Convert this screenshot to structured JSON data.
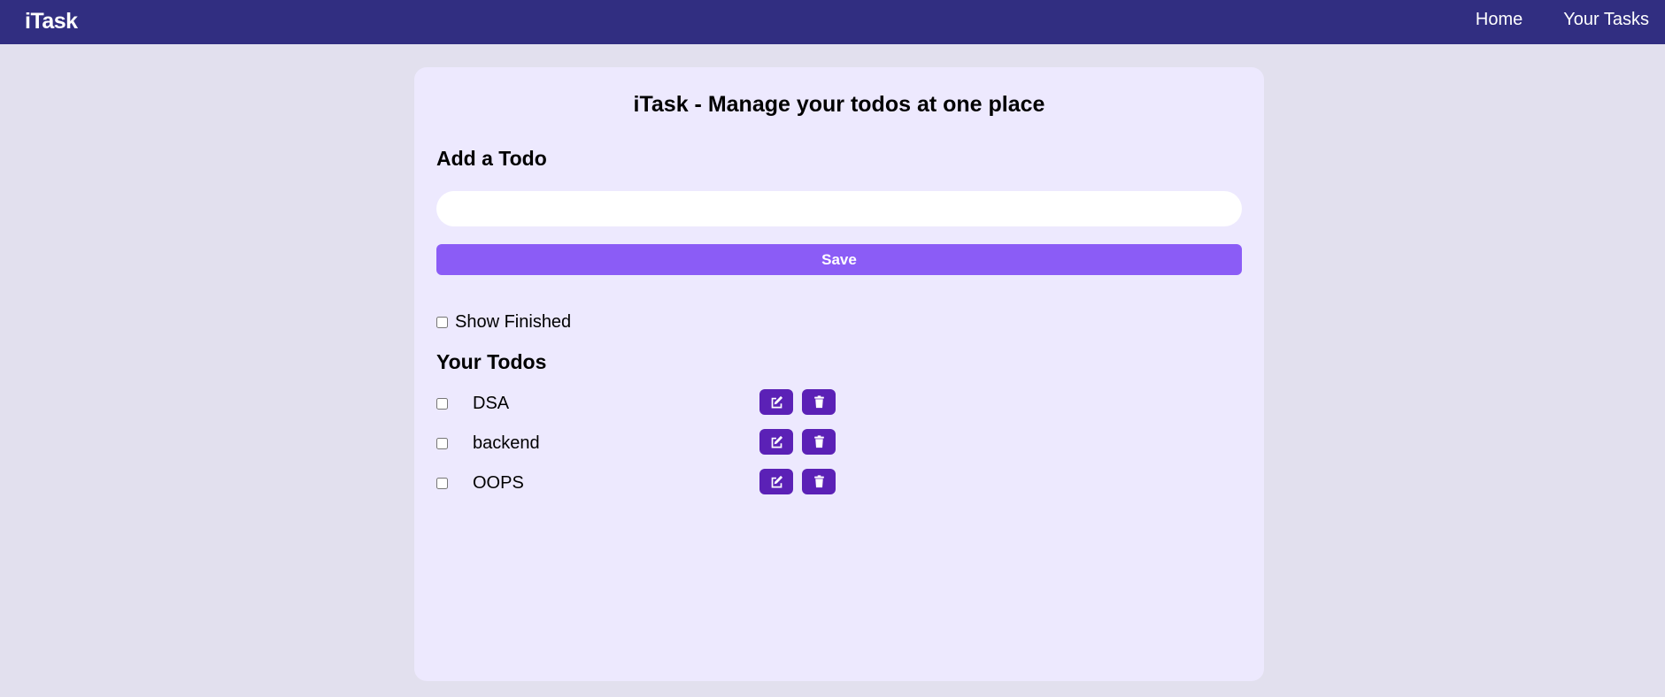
{
  "navbar": {
    "brand": "iTask",
    "links": [
      {
        "label": "Home"
      },
      {
        "label": "Your Tasks"
      }
    ]
  },
  "main": {
    "title": "iTask - Manage your todos at one place",
    "add_heading": "Add a Todo",
    "input": {
      "value": "",
      "placeholder": ""
    },
    "save_label": "Save",
    "show_finished_label": "Show Finished",
    "show_finished_checked": false,
    "todos_heading": "Your Todos",
    "todos": [
      {
        "text": "DSA",
        "completed": false
      },
      {
        "text": "backend",
        "completed": false
      },
      {
        "text": "OOPS",
        "completed": false
      }
    ]
  },
  "icons": {
    "edit": "edit-icon",
    "delete": "trash-icon"
  },
  "colors": {
    "navbar": "#312e81",
    "page_background": "#e2e0ee",
    "card": "#ede9fe",
    "save_button": "#8b5cf6",
    "action_button": "#5b21b6"
  }
}
